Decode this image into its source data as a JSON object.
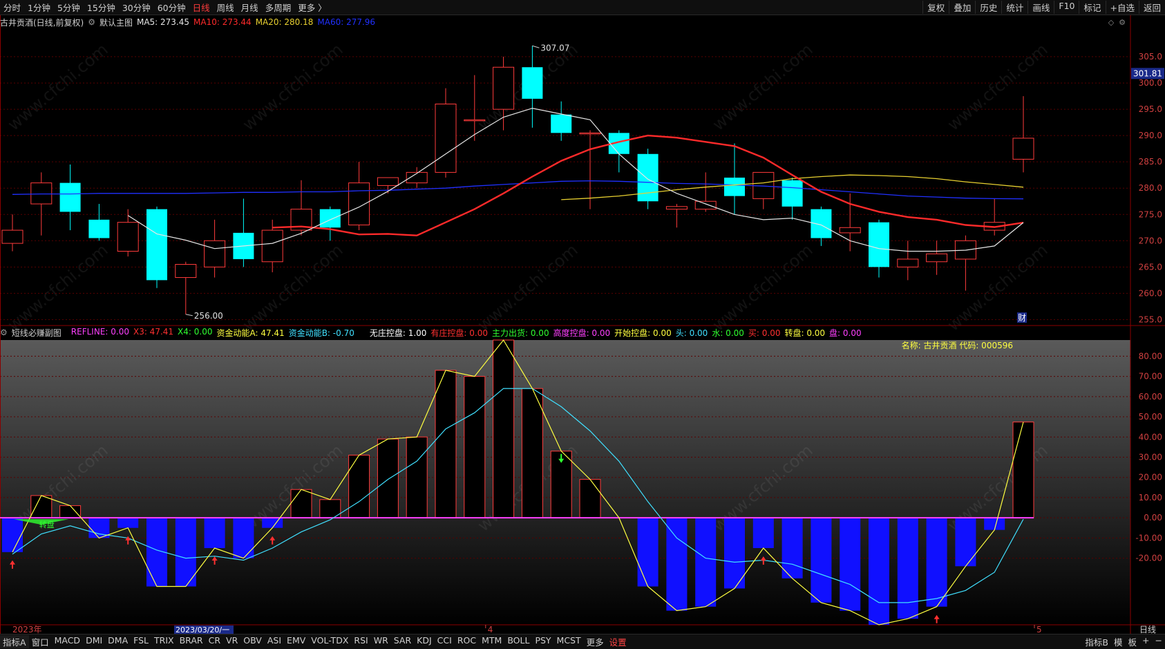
{
  "topbar": {
    "tabs": [
      "分时",
      "1分钟",
      "5分钟",
      "15分钟",
      "30分钟",
      "60分钟",
      "日线",
      "周线",
      "月线",
      "多周期",
      "更多 〉"
    ],
    "active_tab": "日线",
    "right_tabs": [
      "复权",
      "叠加",
      "历史",
      "统计",
      "画线",
      "F10",
      "标记",
      "+自选",
      "返回"
    ]
  },
  "main_legend": {
    "title": "古井贡酒(日线,前复权)",
    "main_label": "默认主图",
    "ma5": "MA5: 273.45",
    "ma10": "MA10: 273.44",
    "ma20": "MA20: 280.18",
    "ma60": "MA60: 277.96",
    "colors": {
      "ma5": "#e6e6e6",
      "ma10": "#ff2a2a",
      "ma20": "#e8d030",
      "ma60": "#2030ff"
    }
  },
  "sub_legend": {
    "title": "短线必赚副图",
    "items": [
      {
        "text": "REFLINE: 0.00",
        "color": "#ff40ff"
      },
      {
        "text": "X3: 47.41",
        "color": "#ff3030"
      },
      {
        "text": "X4: 0.00",
        "color": "#30ff30"
      },
      {
        "text": "资金动能A: 47.41",
        "color": "#ffff40"
      },
      {
        "text": "资金动能B: -0.70",
        "color": "#40e0ff"
      },
      {
        "text": "无庄控盘: 1.00",
        "color": "#ffffff"
      },
      {
        "text": "有庄控盘: 0.00",
        "color": "#ff3030"
      },
      {
        "text": "主力出货: 0.00",
        "color": "#30ff30"
      },
      {
        "text": "高度控盘: 0.00",
        "color": "#ff40ff"
      },
      {
        "text": "开始控盘: 0.00",
        "color": "#ffff40"
      },
      {
        "text": "头: 0.00",
        "color": "#40e0ff"
      },
      {
        "text": "水: 0.00",
        "color": "#30ff30"
      },
      {
        "text": "买: 0.00",
        "color": "#ff3030"
      },
      {
        "text": "转盘: 0.00",
        "color": "#ffff40"
      },
      {
        "text": "盘: 0.00",
        "color": "#ff40ff"
      }
    ],
    "stock_name": "名称: 古井贡酒 代码: 000596"
  },
  "chart_data": [
    {
      "type": "candlestick",
      "y_ticks": [
        255,
        260,
        265,
        270,
        275,
        280,
        285,
        290,
        295,
        300,
        305
      ],
      "ylim": [
        254,
        310
      ],
      "current_price": "301.81",
      "high_label": "307.07",
      "low_label": "256.00",
      "finance_marker": "财",
      "candles": [
        {
          "o": 269.5,
          "h": 275,
          "l": 268,
          "c": 272
        },
        {
          "o": 277,
          "h": 283,
          "l": 271,
          "c": 281
        },
        {
          "o": 281,
          "h": 284.5,
          "l": 272,
          "c": 275.5
        },
        {
          "o": 274,
          "h": 277,
          "l": 270,
          "c": 270.5
        },
        {
          "o": 268,
          "h": 276,
          "l": 267,
          "c": 273.5
        },
        {
          "o": 276,
          "h": 276.5,
          "l": 261,
          "c": 262.5
        },
        {
          "o": 263,
          "h": 266,
          "l": 256,
          "c": 265.5
        },
        {
          "o": 265,
          "h": 274,
          "l": 263,
          "c": 270
        },
        {
          "o": 271.5,
          "h": 278,
          "l": 265,
          "c": 266.5
        },
        {
          "o": 266,
          "h": 274,
          "l": 264,
          "c": 272
        },
        {
          "o": 272,
          "h": 281.5,
          "l": 271,
          "c": 276
        },
        {
          "o": 276,
          "h": 276.5,
          "l": 270,
          "c": 272.5
        },
        {
          "o": 273,
          "h": 285,
          "l": 272,
          "c": 281
        },
        {
          "o": 280.5,
          "h": 282,
          "l": 279,
          "c": 282
        },
        {
          "o": 281,
          "h": 284,
          "l": 280,
          "c": 283
        },
        {
          "o": 283,
          "h": 299,
          "l": 282,
          "c": 296
        },
        {
          "o": 293,
          "h": 301.5,
          "l": 289,
          "c": 293
        },
        {
          "o": 295,
          "h": 305,
          "l": 291,
          "c": 303
        },
        {
          "o": 303,
          "h": 307.07,
          "l": 291.5,
          "c": 297
        },
        {
          "o": 294,
          "h": 296.5,
          "l": 289,
          "c": 290.5
        },
        {
          "o": 290.5,
          "h": 291,
          "l": 276,
          "c": 290.5
        },
        {
          "o": 290.5,
          "h": 291,
          "l": 283,
          "c": 286.5
        },
        {
          "o": 286.5,
          "h": 287.5,
          "l": 276,
          "c": 277.5
        },
        {
          "o": 276,
          "h": 277,
          "l": 272.5,
          "c": 276.5
        },
        {
          "o": 276,
          "h": 283,
          "l": 275.5,
          "c": 277.5
        },
        {
          "o": 282,
          "h": 288.5,
          "l": 275,
          "c": 278.5
        },
        {
          "o": 278,
          "h": 283,
          "l": 276,
          "c": 283
        },
        {
          "o": 281.5,
          "h": 282,
          "l": 274,
          "c": 276.5
        },
        {
          "o": 276,
          "h": 276.5,
          "l": 269,
          "c": 270.5
        },
        {
          "o": 271.5,
          "h": 279,
          "l": 268,
          "c": 272.5
        },
        {
          "o": 273.5,
          "h": 274,
          "l": 263,
          "c": 265
        },
        {
          "o": 265,
          "h": 270,
          "l": 262.5,
          "c": 266.5
        },
        {
          "o": 266,
          "h": 270,
          "l": 263.5,
          "c": 267.5
        },
        {
          "o": 266.5,
          "h": 271,
          "l": 260.5,
          "c": 270
        },
        {
          "o": 272,
          "h": 278,
          "l": 271,
          "c": 273.5
        },
        {
          "o": 285.5,
          "h": 297.5,
          "l": 283,
          "c": 289.5
        }
      ],
      "ma5": [
        null,
        null,
        null,
        null,
        274.8,
        271.3,
        270.1,
        268.5,
        269.0,
        269.5,
        271.4,
        274.0,
        276.4,
        279.4,
        282.8,
        286.5,
        290.2,
        293.5,
        295.2,
        294.1,
        293.0,
        286.5,
        281.7,
        279.0,
        277.0,
        275.0,
        274.0,
        274.3,
        273.0,
        270.0,
        268.5,
        268.0,
        268.0,
        268.2,
        269.0,
        273.45
      ],
      "ma10": [
        null,
        null,
        null,
        null,
        null,
        null,
        null,
        null,
        null,
        272.5,
        272.7,
        272.2,
        271.2,
        271.3,
        271.0,
        273.5,
        276.0,
        279.0,
        282.2,
        285.2,
        287.4,
        288.8,
        290.0,
        289.6,
        288.8,
        288.0,
        285.8,
        282.5,
        279.3,
        277.0,
        275.5,
        274.5,
        274.0,
        273.0,
        272.6,
        273.44
      ],
      "ma20": [
        null,
        null,
        null,
        null,
        null,
        null,
        null,
        null,
        null,
        null,
        null,
        null,
        null,
        null,
        null,
        null,
        null,
        null,
        null,
        277.8,
        278.1,
        278.5,
        279.1,
        279.7,
        280.2,
        280.6,
        281.0,
        281.8,
        282.2,
        282.5,
        282.4,
        282.2,
        281.8,
        281.2,
        280.7,
        280.18
      ],
      "ma60": [
        278.8,
        278.9,
        278.9,
        279.0,
        279.0,
        279.0,
        279.0,
        279.1,
        279.2,
        279.2,
        279.3,
        279.3,
        279.5,
        279.6,
        279.8,
        280.0,
        280.4,
        280.7,
        281.0,
        281.3,
        281.4,
        281.3,
        281.1,
        280.9,
        280.8,
        280.6,
        280.4,
        280.1,
        279.7,
        279.3,
        278.9,
        278.5,
        278.3,
        278.1,
        278.0,
        277.96
      ]
    },
    {
      "type": "bar",
      "y_ticks": [
        -20,
        -10,
        0,
        10,
        20,
        30,
        40,
        50,
        60,
        70,
        80
      ],
      "ylim": [
        -53,
        88
      ],
      "values": [
        -17,
        11,
        6,
        -10,
        -5,
        -34,
        -34,
        -15,
        -20,
        -5,
        14,
        9,
        31,
        39,
        40,
        73,
        70,
        88,
        64,
        33,
        19,
        0,
        -34,
        -46,
        -44,
        -35,
        -15,
        -30,
        -42,
        -46,
        -53,
        -50,
        -44,
        -24,
        -6,
        47.41
      ],
      "line_a": [
        -17,
        11,
        6,
        -10,
        -5,
        -34,
        -34,
        -15,
        -20,
        -5,
        14,
        9,
        31,
        39,
        40,
        73,
        70,
        88,
        64,
        33,
        19,
        0,
        -34,
        -46,
        -44,
        -35,
        -15,
        -30,
        -42,
        -46,
        -53,
        -50,
        -44,
        -24,
        -6,
        47.41
      ],
      "line_b": [
        -18,
        -8,
        -4,
        -8,
        -10,
        -16,
        -20,
        -19,
        -21,
        -15,
        -7,
        -1,
        8,
        19,
        28,
        44,
        52,
        64,
        64,
        55,
        43,
        28,
        8,
        -10,
        -20,
        -22,
        -21,
        -23,
        -28,
        -33,
        -42,
        -42,
        -40,
        -36,
        -27,
        -0.7
      ],
      "buy_markers": [
        0,
        4,
        7,
        9,
        26,
        32
      ],
      "sell_markers": [
        19
      ],
      "turn_label": "转盘",
      "turn_marker_index": 1
    }
  ],
  "x_axis": {
    "year_label": "2023年",
    "date_tooltip": "2023/03/20/一",
    "month_labels": [
      {
        "index": 16,
        "text": "4"
      },
      {
        "index": 35,
        "text": "5"
      }
    ],
    "corner": "日线"
  },
  "bottombar": {
    "tabs": [
      "指标A",
      "窗口",
      "MACD",
      "DMI",
      "DMA",
      "FSL",
      "TRIX",
      "BRAR",
      "CR",
      "VR",
      "OBV",
      "ASI",
      "EMV",
      "VOL-TDX",
      "RSI",
      "WR",
      "SAR",
      "KDJ",
      "CCI",
      "ROC",
      "MTM",
      "BOLL",
      "PSY",
      "MCST",
      "更多"
    ],
    "settings": "设置",
    "right_tabs": [
      "指标B",
      "模",
      "板",
      "+",
      "−"
    ]
  },
  "watermark": "www.cfchi.com"
}
